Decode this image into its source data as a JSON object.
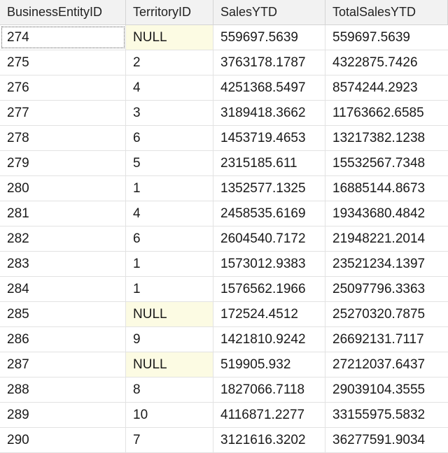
{
  "grid": {
    "columns": [
      "BusinessEntityID",
      "TerritoryID",
      "SalesYTD",
      "TotalSalesYTD"
    ],
    "rows": [
      [
        "274",
        "NULL",
        "559697.5639",
        "559697.5639"
      ],
      [
        "275",
        "2",
        "3763178.1787",
        "4322875.7426"
      ],
      [
        "276",
        "4",
        "4251368.5497",
        "8574244.2923"
      ],
      [
        "277",
        "3",
        "3189418.3662",
        "11763662.6585"
      ],
      [
        "278",
        "6",
        "1453719.4653",
        "13217382.1238"
      ],
      [
        "279",
        "5",
        "2315185.611",
        "15532567.7348"
      ],
      [
        "280",
        "1",
        "1352577.1325",
        "16885144.8673"
      ],
      [
        "281",
        "4",
        "2458535.6169",
        "19343680.4842"
      ],
      [
        "282",
        "6",
        "2604540.7172",
        "21948221.2014"
      ],
      [
        "283",
        "1",
        "1573012.9383",
        "23521234.1397"
      ],
      [
        "284",
        "1",
        "1576562.1966",
        "25097796.3363"
      ],
      [
        "285",
        "NULL",
        "172524.4512",
        "25270320.7875"
      ],
      [
        "286",
        "9",
        "1421810.9242",
        "26692131.7117"
      ],
      [
        "287",
        "NULL",
        "519905.932",
        "27212037.6437"
      ],
      [
        "288",
        "8",
        "1827066.7118",
        "29039104.3555"
      ],
      [
        "289",
        "10",
        "4116871.2277",
        "33155975.5832"
      ],
      [
        "290",
        "7",
        "3121616.3202",
        "36277591.9034"
      ]
    ]
  },
  "colors": {
    "null_cell_background": "#fcfbe3",
    "header_background": "#f2f2f2",
    "gridline": "#e2e2e2"
  }
}
